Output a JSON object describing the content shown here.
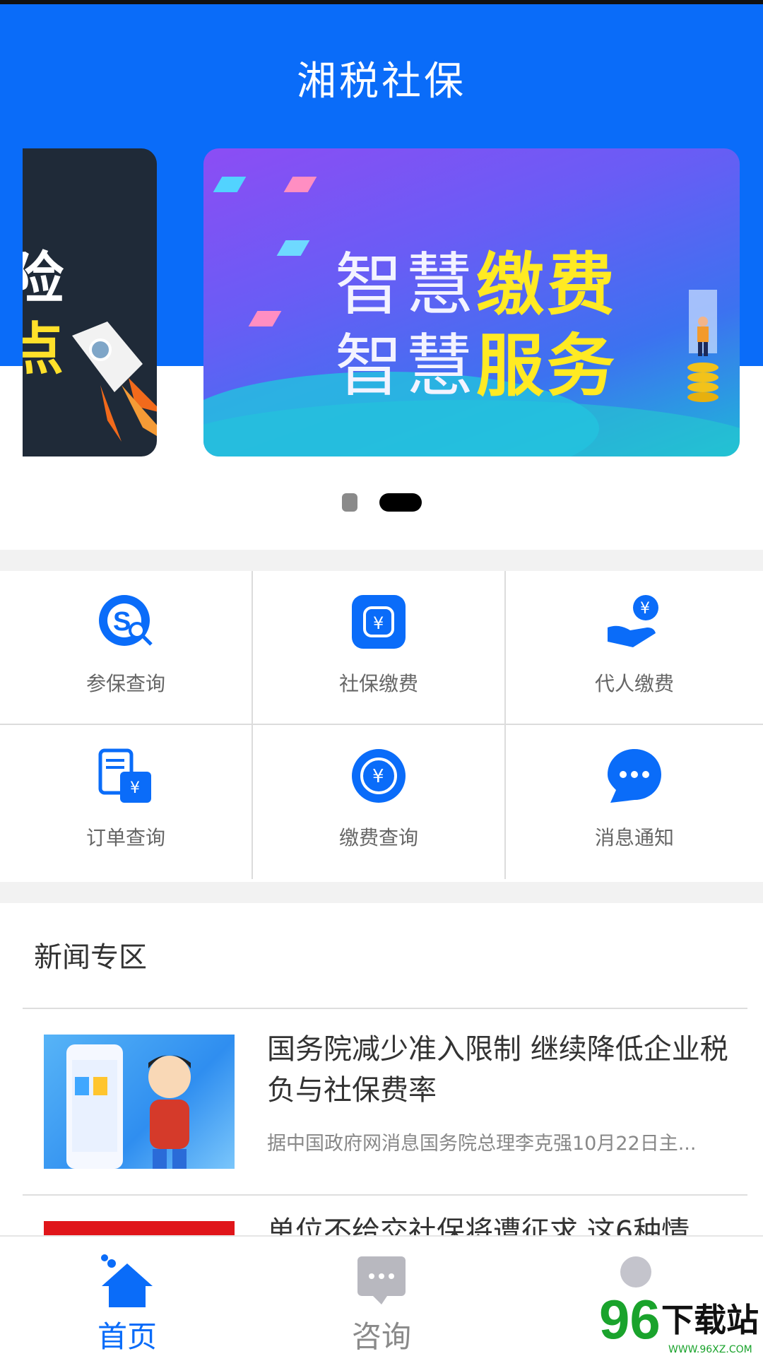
{
  "app": {
    "title": "湘税社保"
  },
  "banner": {
    "prev_text_line1": "险",
    "prev_text_line2": "点",
    "slogan_line1_white": "智慧",
    "slogan_line1_yellow": "缴费",
    "slogan_line2_white": "智慧",
    "slogan_line2_yellow": "服务",
    "active_index": 1,
    "count": 2
  },
  "services": [
    {
      "label": "参保查询",
      "icon": "insurance-search-icon"
    },
    {
      "label": "社保缴费",
      "icon": "wallet-payment-icon"
    },
    {
      "label": "代人缴费",
      "icon": "hand-coin-icon"
    },
    {
      "label": "订单查询",
      "icon": "order-receipt-icon"
    },
    {
      "label": "缴费查询",
      "icon": "yuan-refresh-icon"
    },
    {
      "label": "消息通知",
      "icon": "chat-bubble-icon"
    }
  ],
  "news": {
    "section_title": "新闻专区",
    "items": [
      {
        "title": "国务院减少准入限制 继续降低企业税负与社保费率",
        "summary": "据中国政府网消息国务院总理李克强10月22日主..."
      },
      {
        "title": "单位不给交社保将遭征求 这6种情",
        "summary": ""
      }
    ]
  },
  "tabbar": {
    "items": [
      {
        "label": "首页",
        "active": true
      },
      {
        "label": "咨询",
        "active": false
      },
      {
        "label": "",
        "active": false
      }
    ]
  },
  "colors": {
    "brand": "#0a6cf9",
    "accent_yellow": "#ffea23",
    "inactive": "#9a9a9a"
  },
  "watermark": {
    "text_main": "下载站",
    "text_num": "96",
    "url": "WWW.96XZ.COM"
  }
}
